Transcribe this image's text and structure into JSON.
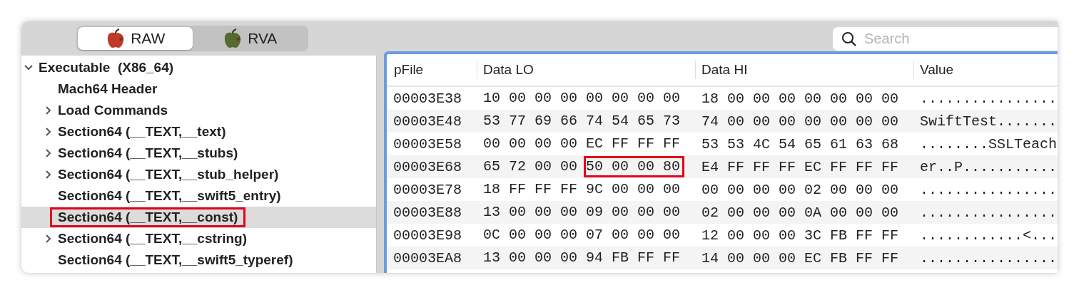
{
  "toolbar": {
    "segments": [
      {
        "label": "RAW",
        "selected": true,
        "color": "#c0392b"
      },
      {
        "label": "RVA",
        "selected": false,
        "color": "#556b2f"
      }
    ],
    "search": {
      "placeholder": "Search"
    }
  },
  "tree": [
    {
      "label": "Executable  (X86_64)",
      "expanded": true,
      "selected": false,
      "marked": false,
      "children": [
        {
          "label": "Mach64 Header",
          "expandable": false,
          "selected": false,
          "marked": false
        },
        {
          "label": "Load Commands",
          "expandable": true,
          "selected": false,
          "marked": false
        },
        {
          "label": "Section64 (__TEXT,__text)",
          "expandable": true,
          "selected": false,
          "marked": false
        },
        {
          "label": "Section64 (__TEXT,__stubs)",
          "expandable": true,
          "selected": false,
          "marked": false
        },
        {
          "label": "Section64 (__TEXT,__stub_helper)",
          "expandable": true,
          "selected": false,
          "marked": false
        },
        {
          "label": "Section64 (__TEXT,__swift5_entry)",
          "expandable": false,
          "selected": false,
          "marked": false
        },
        {
          "label": "Section64 (__TEXT,__const)",
          "expandable": false,
          "selected": true,
          "marked": true
        },
        {
          "label": "Section64 (__TEXT,__cstring)",
          "expandable": true,
          "selected": false,
          "marked": false
        },
        {
          "label": "Section64 (__TEXT,__swift5_typeref)",
          "expandable": false,
          "selected": false,
          "marked": false
        }
      ]
    }
  ],
  "table": {
    "columns": [
      "pFile",
      "Data LO",
      "Data HI",
      "Value"
    ],
    "rows": [
      {
        "pfile": "00003E38",
        "data_lo": [
          {
            "bytes": "10 00 00 00",
            "marked": false
          },
          {
            "bytes": "00 00 00 00",
            "marked": false
          }
        ],
        "data_hi": "18 00 00 00 00 00 00 00",
        "value": "................"
      },
      {
        "pfile": "00003E48",
        "data_lo": [
          {
            "bytes": "53 77 69 66",
            "marked": false
          },
          {
            "bytes": "74 54 65 73",
            "marked": false
          }
        ],
        "data_hi": "74 00 00 00 00 00 00 00",
        "value": "SwiftTest......."
      },
      {
        "pfile": "00003E58",
        "data_lo": [
          {
            "bytes": "00 00 00 00",
            "marked": false
          },
          {
            "bytes": "EC FF FF FF",
            "marked": false
          }
        ],
        "data_hi": "53 53 4C 54 65 61 63 68",
        "value": "........SSLTeach"
      },
      {
        "pfile": "00003E68",
        "data_lo": [
          {
            "bytes": "65 72 00 00",
            "marked": false
          },
          {
            "bytes": "50 00 00 80",
            "marked": true
          }
        ],
        "data_hi": "E4 FF FF FF EC FF FF FF",
        "value": "er..P..........."
      },
      {
        "pfile": "00003E78",
        "data_lo": [
          {
            "bytes": "18 FF FF FF",
            "marked": false
          },
          {
            "bytes": "9C 00 00 00",
            "marked": false
          }
        ],
        "data_hi": "00 00 00 00 02 00 00 00",
        "value": "................"
      },
      {
        "pfile": "00003E88",
        "data_lo": [
          {
            "bytes": "13 00 00 00",
            "marked": false
          },
          {
            "bytes": "09 00 00 00",
            "marked": false
          }
        ],
        "data_hi": "02 00 00 00 0A 00 00 00",
        "value": "................"
      },
      {
        "pfile": "00003E98",
        "data_lo": [
          {
            "bytes": "0C 00 00 00",
            "marked": false
          },
          {
            "bytes": "07 00 00 00",
            "marked": false
          }
        ],
        "data_hi": "12 00 00 00 3C FB FF FF",
        "value": "............<..."
      },
      {
        "pfile": "00003EA8",
        "data_lo": [
          {
            "bytes": "13 00 00 00",
            "marked": false
          },
          {
            "bytes": "94 FB FF FF",
            "marked": false
          }
        ],
        "data_hi": "14 00 00 00 EC FB FF FF",
        "value": "................"
      }
    ]
  }
}
